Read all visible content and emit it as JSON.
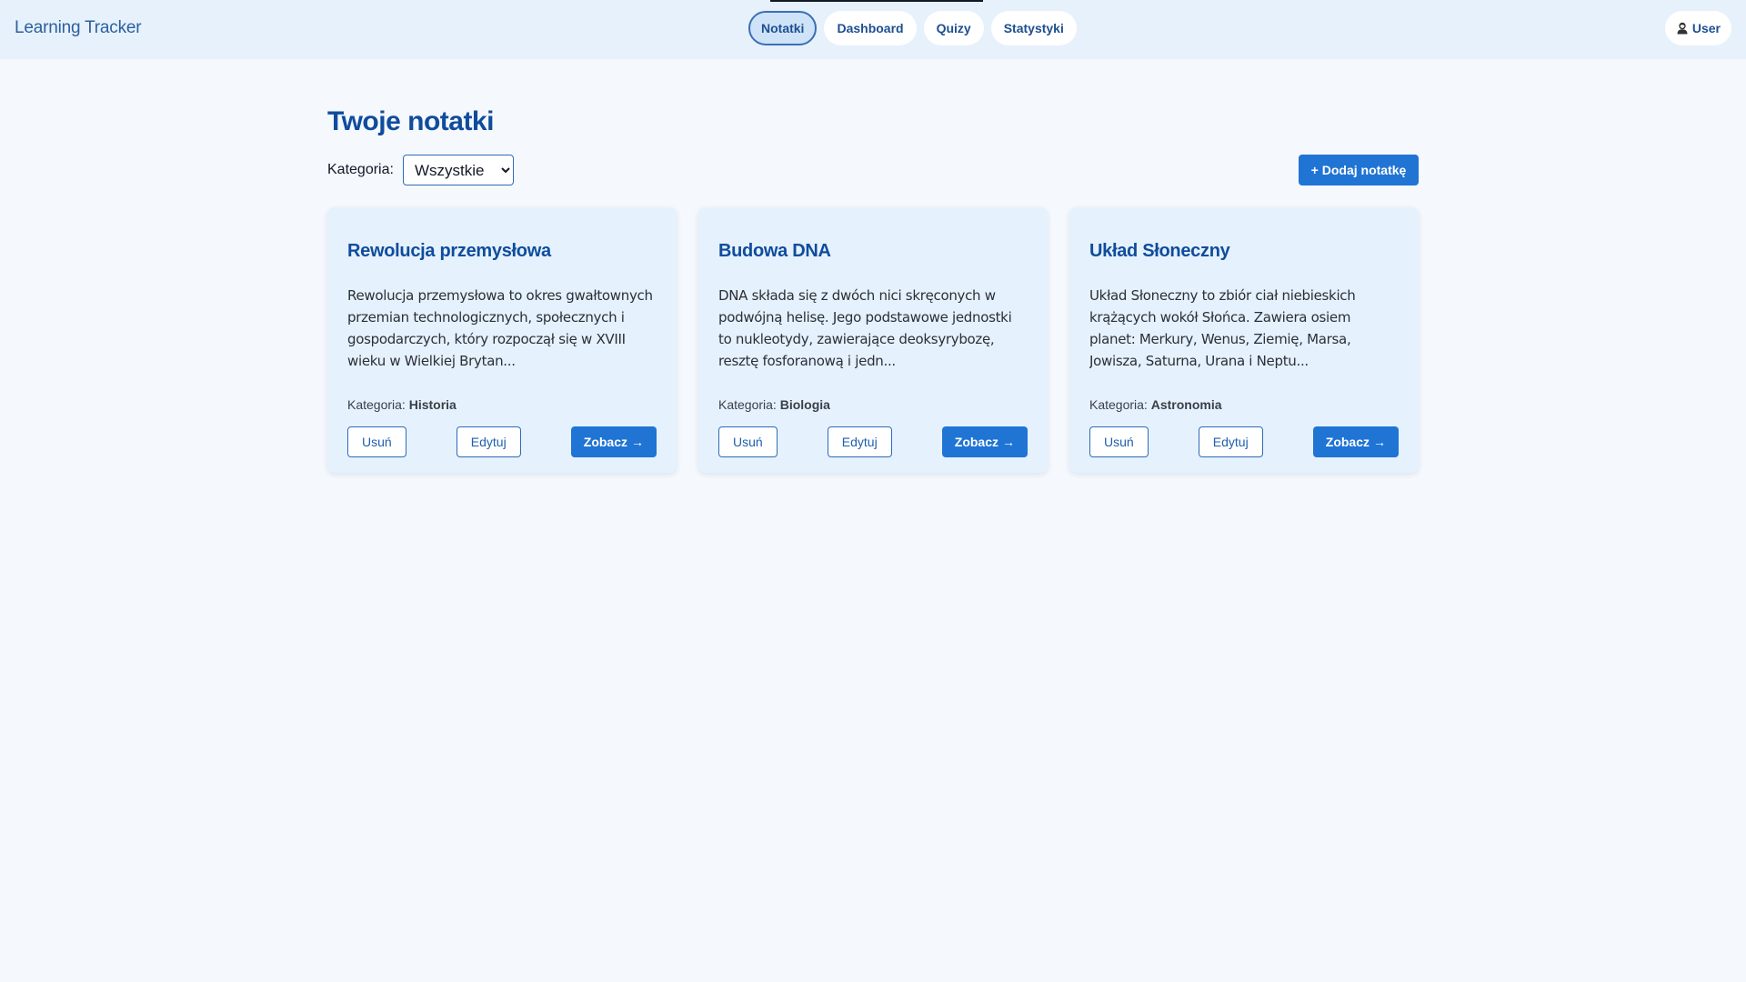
{
  "app": {
    "brand": "Learning Tracker"
  },
  "nav": {
    "tabs": [
      {
        "label": "Notatki",
        "active": true
      },
      {
        "label": "Dashboard",
        "active": false
      },
      {
        "label": "Quizy",
        "active": false
      },
      {
        "label": "Statystyki",
        "active": false
      }
    ],
    "user_label": "User",
    "user_icon": "user-icon"
  },
  "main": {
    "title": "Twoje notatki",
    "filter": {
      "label": "Kategoria:",
      "selected": "Wszystkie",
      "options": [
        "Wszystkie"
      ]
    },
    "add_button": "+ Dodaj notatkę"
  },
  "notes": [
    {
      "title": "Rewolucja przemysłowa",
      "excerpt": "Rewolucja przemysłowa to okres gwałtownych przemian technologicznych, społecznych i gospodarczych, który rozpoczął się w XVIII wieku w Wielkiej Brytan...",
      "category_label": "Kategoria:",
      "category": "Historia",
      "delete_label": "Usuń",
      "edit_label": "Edytuj",
      "view_label": "Zobacz",
      "view_arrow": "→"
    },
    {
      "title": "Budowa DNA",
      "excerpt": "DNA składa się z dwóch nici skręconych w podwójną helisę. Jego podstawowe jednostki to nukleotydy, zawierające deoksyrybozę, resztę fosforanową i jedn...",
      "category_label": "Kategoria:",
      "category": "Biologia",
      "delete_label": "Usuń",
      "edit_label": "Edytuj",
      "view_label": "Zobacz",
      "view_arrow": "→"
    },
    {
      "title": "Układ Słoneczny",
      "excerpt": "Układ Słoneczny to zbiór ciał niebieskich krążących wokół Słońca. Zawiera osiem planet: Merkury, Wenus, Ziemię, Marsa, Jowisza, Saturna, Urana i Neptu...",
      "category_label": "Kategoria:",
      "category": "Astronomia",
      "delete_label": "Usuń",
      "edit_label": "Edytuj",
      "view_label": "Zobacz",
      "view_arrow": "→"
    }
  ],
  "colors": {
    "background": "#f5f8fc",
    "header": "#e6f1fb",
    "card": "#e5f1fd",
    "accent": "#1f74d4",
    "title": "#0f4c9c"
  }
}
